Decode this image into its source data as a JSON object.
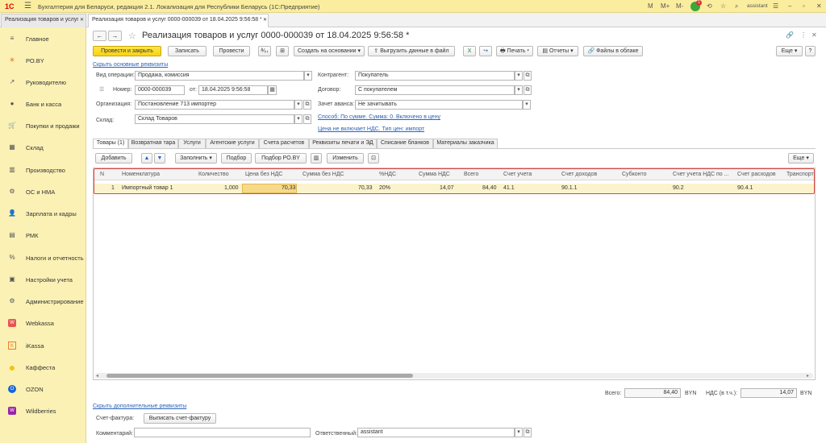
{
  "app": {
    "logo": "1С",
    "title": "Бухгалтерия для Беларуси, редакция 2.1. Локализация для Республики Беларусь  (1С:Предприятие)",
    "user": "assistant",
    "notif_count": "1",
    "top_icons": [
      "M",
      "M+",
      "M-"
    ]
  },
  "window_tabs": [
    {
      "label": "Реализация товаров и услуг"
    },
    {
      "label": "Реализация товаров и услуг 0000-000039 от 18.04.2025 9:56:58 *"
    }
  ],
  "sidebar": {
    "items": [
      {
        "label": "Главное",
        "icon": "≡"
      },
      {
        "label": "РО.BY",
        "icon": "✳"
      },
      {
        "label": "Руководителю",
        "icon": "↗"
      },
      {
        "label": "Банк и касса",
        "icon": "●"
      },
      {
        "label": "Покупки и продажи",
        "icon": "🛒"
      },
      {
        "label": "Склад",
        "icon": "▦"
      },
      {
        "label": "Производство",
        "icon": "▥"
      },
      {
        "label": "ОС и НМА",
        "icon": "⚙"
      },
      {
        "label": "Зарплата и кадры",
        "icon": "👤"
      },
      {
        "label": "РМК",
        "icon": "▤"
      },
      {
        "label": "Налоги и отчетность",
        "icon": "%"
      },
      {
        "label": "Настройки учета",
        "icon": "▣"
      },
      {
        "label": "Администрирование",
        "icon": "⚙"
      },
      {
        "label": "Webkassa",
        "icon": "W"
      },
      {
        "label": "iKassa",
        "icon": "K"
      },
      {
        "label": "Каффеста",
        "icon": "●"
      },
      {
        "label": "OZON",
        "icon": "O"
      },
      {
        "label": "Wildberries",
        "icon": "W"
      }
    ]
  },
  "document": {
    "title": "Реализация товаров и услуг 0000-000039 от 18.04.2025 9:56:58 *"
  },
  "toolbar": {
    "post_close": "Провести и закрыть",
    "save": "Записать",
    "post": "Провести",
    "create_based": "Создать на основании",
    "upload": "Выгрузить данные в файл",
    "print": "Печать",
    "reports": "Отчеты",
    "cloud": "Файлы в облаке",
    "more": "Еще"
  },
  "form": {
    "hide_link": "Скрыть основные реквизиты",
    "op_type_label": "Вид операции:",
    "op_type_value": "Продажа, комиссия",
    "number_label": "Номер:",
    "number_value": "0000-000039",
    "date_label": "от:",
    "date_value": "18.04.2025  9:56:58",
    "org_label": "Организация:",
    "org_value": "Постановление 713 импортер",
    "warehouse_label": "Склад:",
    "warehouse_value": "Склад Товаров",
    "counterparty_label": "Контрагент:",
    "counterparty_value": "Покупатель",
    "contract_label": "Договор:",
    "contract_value": "С покупателем",
    "advance_label": "Зачет аванса:",
    "advance_value": "Не зачитывать",
    "method_link": "Способ: По сумме. Сумма: 0. Включено в цену",
    "vat_link": "Цена не включает НДС. Тип цен: импорт"
  },
  "tabs": [
    {
      "label": "Товары (1)"
    },
    {
      "label": "Возвратная тара"
    },
    {
      "label": "Услуги"
    },
    {
      "label": "Агентские услуги"
    },
    {
      "label": "Счета расчетов"
    },
    {
      "label": "Реквизиты печати и ЭД"
    },
    {
      "label": "Списание бланков"
    },
    {
      "label": "Материалы заказчика"
    }
  ],
  "table_toolbar": {
    "add": "Добавить",
    "fill": "Заполнить",
    "select": "Подбор",
    "select_ro": "Подбор РО.BY",
    "change": "Изменить",
    "more": "Еще"
  },
  "table": {
    "columns": [
      "N",
      "Номенклатура",
      "Количество",
      "Цена без НДС",
      "Сумма без НДС",
      "%НДС",
      "Сумма НДС",
      "Всего",
      "Счет учета",
      "Счет доходов",
      "Субконто",
      "Счет учета НДС по ...",
      "Счет расходов",
      "Транспорт"
    ],
    "rows": [
      [
        "1",
        "Импортный товар 1",
        "1,000",
        "70,33",
        "70,33",
        "20%",
        "14,07",
        "84,40",
        "41.1",
        "90.1.1",
        "",
        "90.2",
        "90.4.1",
        ""
      ]
    ]
  },
  "totals": {
    "total_label": "Всего:",
    "total_value": "84,40",
    "currency": "BYN",
    "vat_label": "НДС (в т.ч.):",
    "vat_value": "14,07",
    "currency2": "BYN"
  },
  "footer": {
    "extra_link": "Скрыть дополнительные реквизиты",
    "invoice_label": "Счет-фактура:",
    "invoice_button": "Выписать счет-фактуру",
    "comment_label": "Комментарий:",
    "comment_value": "",
    "responsible_label": "Ответственный:",
    "responsible_value": "assistant"
  }
}
